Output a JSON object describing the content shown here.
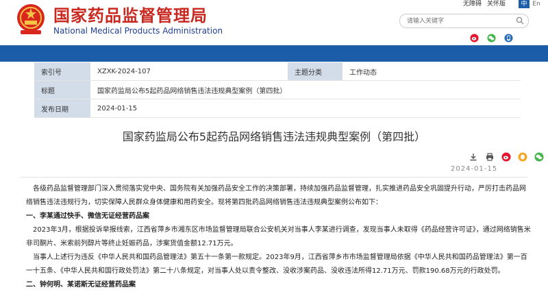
{
  "header": {
    "site_name_cn": "国家药品监督管理局",
    "site_name_en": "National Medical Products Administration",
    "accessibility_link": "无障碍",
    "close_link": "关怀版",
    "lang_cn": "中",
    "lang_en": "En",
    "search_placeholder": "请输入关键字",
    "social_icons": [
      "weibo-icon",
      "wechat-icon",
      "app-icon"
    ],
    "brand_red": "#c8281f",
    "brand_blue": "#1f3f93"
  },
  "meta_table": {
    "index_label": "索引号",
    "index_value": "XZXK-2024-107",
    "topic_label": "主题分类",
    "topic_value": "工作动态",
    "title_label": "标题",
    "title_value": "国家药监局公布5起药品网络销售违法违规典型案例（第四批）",
    "date_label": "发布日期",
    "date_value": "2024-01-15"
  },
  "article": {
    "title": "国家药监局公布5起药品网络销售违法违规典型案例（第四批）",
    "date": "2024-01-15",
    "tools": [
      "download-icon",
      "print-icon",
      "weibo-share-icon",
      "qq-share-icon",
      "wechat-share-icon"
    ],
    "paragraphs": [
      {
        "type": "para",
        "text": "　各级药品监督管理部门深入贯彻落实党中央、国务院有关加强药品安全工作的决策部署，持续加强药品监督管理，扎实推进药品安全巩固提升行动，严厉打击药品网络销售违法违规行为，切实保障人民群众身体健康和用药安全。现将第四批药品网络销售违法违规典型案例公布如下："
      },
      {
        "type": "sec",
        "text": "一、李某通过快手、微信无证经营药品案"
      },
      {
        "type": "para",
        "text": "　2023年3月，根据投诉举报线索，江西省萍乡市湘东区市场监督管理局联合公安机关对当事人李某进行调查，发现当事人未取得《药品经营许可证》，通过网络销售米非司酮片、米索前列醇片等终止妊娠药品，涉案货值金额12.71万元。"
      },
      {
        "type": "para",
        "text": "　当事人上述行为违反《中华人民共和国药品管理法》第五十一条第一款规定。2023年9月，江西省萍乡市市场监督管理局依据《中华人民共和国药品管理法》第一百一十五条、《中华人民共和国行政处罚法》第二十八条规定，对当事人处以责令整改、没收涉案药品、没收违法所得12.71万元、罚款190.68万元的行政处罚。"
      },
      {
        "type": "sec",
        "text": "二、钟何明、某诺斯无证经营药品案"
      }
    ]
  }
}
